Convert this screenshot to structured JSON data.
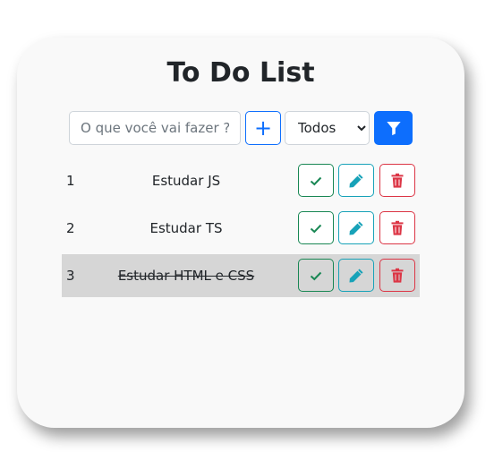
{
  "app": {
    "title": "To Do List"
  },
  "toolbar": {
    "input_placeholder": "O que você vai fazer ?",
    "input_value": "",
    "add_label": "+",
    "filter_selected": "Todos",
    "add_icon": "plus-icon",
    "filter_icon": "filter-icon"
  },
  "colors": {
    "primary": "#0d6efd",
    "success": "#198754",
    "info": "#17a2b8",
    "danger": "#dc3545",
    "done_row_bg": "#d6d6d6"
  },
  "tasks": [
    {
      "id": "1",
      "text": "Estudar JS",
      "done": false
    },
    {
      "id": "2",
      "text": "Estudar TS",
      "done": false
    },
    {
      "id": "3",
      "text": "Estudar HTML e CSS",
      "done": true
    }
  ],
  "row_actions": {
    "complete_icon": "check-icon",
    "edit_icon": "pencil-icon",
    "delete_icon": "trash-icon"
  }
}
